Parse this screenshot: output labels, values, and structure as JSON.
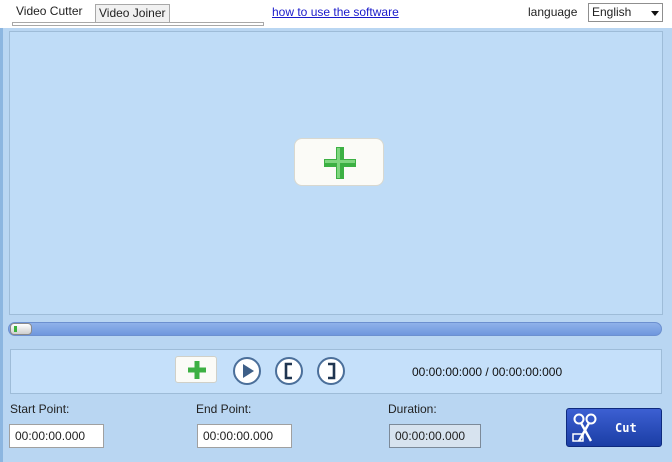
{
  "tabs": [
    {
      "label": "Video Cutter"
    },
    {
      "label": "Video Joiner"
    }
  ],
  "help_link": "how to use the software",
  "language": {
    "label": "language",
    "selected": "English"
  },
  "controls": {
    "time_readout": "00:00:00:000 / 00:00:00:000"
  },
  "fields": {
    "start_label": "Start Point:",
    "start_value": "00:00:00.000",
    "end_label": "End Point:",
    "end_value": "00:00:00.000",
    "duration_label": "Duration:",
    "duration_value": "00:00:00.000"
  },
  "cut_button": {
    "label": "Cut"
  },
  "progress": {
    "position_fraction": 0.0
  },
  "colors": {
    "background": "#b9d6f2",
    "preview": "#bfdcf7",
    "add_green": "#3cb043",
    "cut_button": "#1b3ea5",
    "link": "#1a1acb"
  }
}
